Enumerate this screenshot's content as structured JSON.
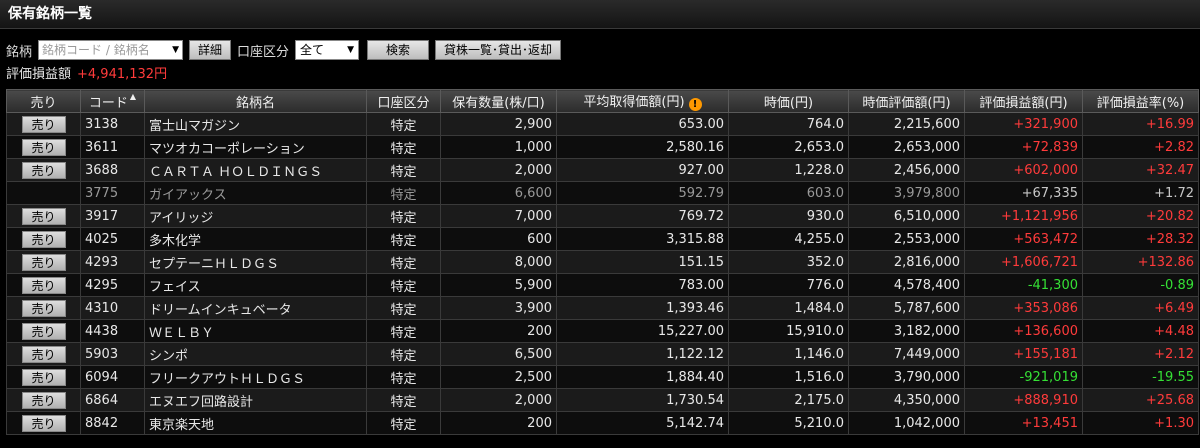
{
  "header": {
    "title": "保有銘柄一覧"
  },
  "filter": {
    "stock_label": "銘柄",
    "stock_placeholder": "銘柄コード / 銘柄名",
    "detail_button": "詳細",
    "account_label": "口座区分",
    "account_selected": "全て",
    "search_button": "検索",
    "lending_button": "貸株一覧･貸出･返却"
  },
  "summary": {
    "label": "評価損益額",
    "value": "+4,941,132円"
  },
  "table": {
    "headers": {
      "sell": "売り",
      "code": "コード",
      "name": "銘柄名",
      "account": "口座区分",
      "qty": "保有数量(株/口)",
      "avg": "平均取得価額(円)",
      "price": "時価(円)",
      "value": "時価評価額(円)",
      "pl": "評価損益額(円)",
      "plrate": "評価損益率(%)"
    },
    "sell_label": "売り",
    "rows": [
      {
        "sellable": true,
        "code": "3138",
        "name": "富士山マガジン",
        "account": "特定",
        "qty": "2,900",
        "avg": "653.00",
        "price": "764.0",
        "value": "2,215,600",
        "pl": "+321,900",
        "plrate": "+16.99",
        "sign": "pos"
      },
      {
        "sellable": true,
        "code": "3611",
        "name": "マツオカコーポレーション",
        "account": "特定",
        "qty": "1,000",
        "avg": "2,580.16",
        "price": "2,653.0",
        "value": "2,653,000",
        "pl": "+72,839",
        "plrate": "+2.82",
        "sign": "pos"
      },
      {
        "sellable": true,
        "code": "3688",
        "name": "ＣＡＲＴＡ ＨＯＬＤＩＮＧＳ",
        "account": "特定",
        "qty": "2,000",
        "avg": "927.00",
        "price": "1,228.0",
        "value": "2,456,000",
        "pl": "+602,000",
        "plrate": "+32.47",
        "sign": "pos"
      },
      {
        "sellable": false,
        "code": "3775",
        "name": "ガイアックス",
        "account": "特定",
        "qty": "6,600",
        "avg": "592.79",
        "price": "603.0",
        "value": "3,979,800",
        "pl": "+67,335",
        "plrate": "+1.72",
        "sign": "pos"
      },
      {
        "sellable": true,
        "code": "3917",
        "name": "アイリッジ",
        "account": "特定",
        "qty": "7,000",
        "avg": "769.72",
        "price": "930.0",
        "value": "6,510,000",
        "pl": "+1,121,956",
        "plrate": "+20.82",
        "sign": "pos"
      },
      {
        "sellable": true,
        "code": "4025",
        "name": "多木化学",
        "account": "特定",
        "qty": "600",
        "avg": "3,315.88",
        "price": "4,255.0",
        "value": "2,553,000",
        "pl": "+563,472",
        "plrate": "+28.32",
        "sign": "pos"
      },
      {
        "sellable": true,
        "code": "4293",
        "name": "セプテーニＨＬＤＧＳ",
        "account": "特定",
        "qty": "8,000",
        "avg": "151.15",
        "price": "352.0",
        "value": "2,816,000",
        "pl": "+1,606,721",
        "plrate": "+132.86",
        "sign": "pos"
      },
      {
        "sellable": true,
        "code": "4295",
        "name": "フェイス",
        "account": "特定",
        "qty": "5,900",
        "avg": "783.00",
        "price": "776.0",
        "value": "4,578,400",
        "pl": "-41,300",
        "plrate": "-0.89",
        "sign": "neg"
      },
      {
        "sellable": true,
        "code": "4310",
        "name": "ドリームインキュベータ",
        "account": "特定",
        "qty": "3,900",
        "avg": "1,393.46",
        "price": "1,484.0",
        "value": "5,787,600",
        "pl": "+353,086",
        "plrate": "+6.49",
        "sign": "pos"
      },
      {
        "sellable": true,
        "code": "4438",
        "name": "ＷＥＬＢＹ",
        "account": "特定",
        "qty": "200",
        "avg": "15,227.00",
        "price": "15,910.0",
        "value": "3,182,000",
        "pl": "+136,600",
        "plrate": "+4.48",
        "sign": "pos"
      },
      {
        "sellable": true,
        "code": "5903",
        "name": "シンポ",
        "account": "特定",
        "qty": "6,500",
        "avg": "1,122.12",
        "price": "1,146.0",
        "value": "7,449,000",
        "pl": "+155,181",
        "plrate": "+2.12",
        "sign": "pos"
      },
      {
        "sellable": true,
        "code": "6094",
        "name": "フリークアウトＨＬＤＧＳ",
        "account": "特定",
        "qty": "2,500",
        "avg": "1,884.40",
        "price": "1,516.0",
        "value": "3,790,000",
        "pl": "-921,019",
        "plrate": "-19.55",
        "sign": "neg"
      },
      {
        "sellable": true,
        "code": "6864",
        "name": "エヌエフ回路設計",
        "account": "特定",
        "qty": "2,000",
        "avg": "1,730.54",
        "price": "2,175.0",
        "value": "4,350,000",
        "pl": "+888,910",
        "plrate": "+25.68",
        "sign": "pos"
      },
      {
        "sellable": true,
        "code": "8842",
        "name": "東京楽天地",
        "account": "特定",
        "qty": "200",
        "avg": "5,142.74",
        "price": "5,210.0",
        "value": "1,042,000",
        "pl": "+13,451",
        "plrate": "+1.30",
        "sign": "pos"
      }
    ]
  }
}
